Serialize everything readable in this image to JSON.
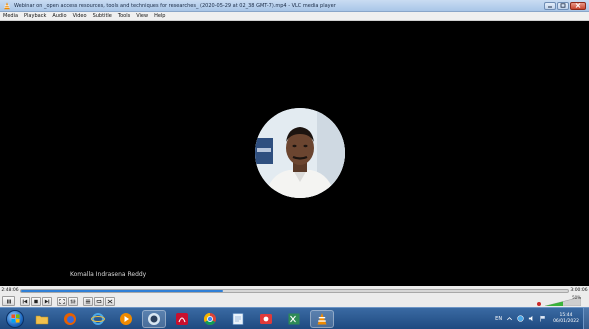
{
  "window": {
    "title": "Webinar on _open access resources, tools and techniques for researches_ (2020-05-29 at 02_38 GMT-7).mp4 - VLC media player"
  },
  "menu": {
    "items": [
      {
        "label": "Media"
      },
      {
        "label": "Playback"
      },
      {
        "label": "Audio"
      },
      {
        "label": "Video"
      },
      {
        "label": "Subtitle"
      },
      {
        "label": "Tools"
      },
      {
        "label": "View"
      },
      {
        "label": "Help"
      }
    ]
  },
  "video": {
    "speaker_name": "Komalla Indrasena Reddy"
  },
  "seek": {
    "elapsed": "2:48:06",
    "total": "3:00:06",
    "progress_fraction": 0.37
  },
  "volume": {
    "percent_label": "50%",
    "level_fraction": 0.5
  },
  "taskbar": {
    "language": "EN",
    "clock_time": "15:44",
    "clock_date": "06/01/2022"
  },
  "colors": {
    "seek_fill": "#2f7fd6",
    "taskbar": "#2a5a93",
    "vlc_orange": "#f08a00"
  }
}
